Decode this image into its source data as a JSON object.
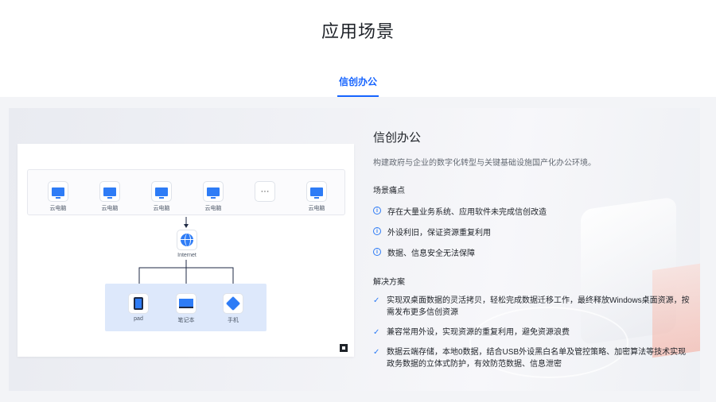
{
  "header": {
    "title": "应用场景"
  },
  "tabs": [
    {
      "label": "信创办公",
      "active": true
    }
  ],
  "diagram": {
    "clients": [
      {
        "label": "云电脑",
        "icon": "monitor-cloud-icon"
      },
      {
        "label": "云电脑",
        "icon": "monitor-cloud-icon"
      },
      {
        "label": "云电脑",
        "icon": "monitor-cloud-icon"
      },
      {
        "label": "云电脑",
        "icon": "monitor-cloud-icon"
      },
      {
        "label": "",
        "icon": "ellipsis-icon"
      },
      {
        "label": "云电脑",
        "icon": "monitor-cloud-icon"
      }
    ],
    "network_label": "Internet",
    "devices": [
      {
        "label": "pad",
        "icon": "tablet-icon"
      },
      {
        "label": "笔记本",
        "icon": "laptop-icon"
      },
      {
        "label": "手机",
        "icon": "phone-icon"
      }
    ]
  },
  "scenario": {
    "title": "信创办公",
    "description": "构建政府与企业的数字化转型与关键基础设施国产化办公环境。",
    "pain_title": "场景痛点",
    "pain_points": [
      "存在大量业务系统、应用软件未完成信创改造",
      "外设利旧，保证资源重复利用",
      "数据、信息安全无法保障"
    ],
    "solution_title": "解决方案",
    "solutions": [
      "实现双桌面数据的灵活拷贝，轻松完成数据迁移工作，最终释放Windows桌面资源，按需发布更多信创资源",
      "兼容常用外设，实现资源的重复利用，避免资源浪费",
      "数据云端存储，本地0数据，结合USB外设黑白名单及管控策略、加密算法等技术实现政务数据的立体式防护，有效防范数据、信息泄密"
    ]
  },
  "colors": {
    "accent": "#1664ff",
    "icon_blue": "#2e7cf6"
  }
}
